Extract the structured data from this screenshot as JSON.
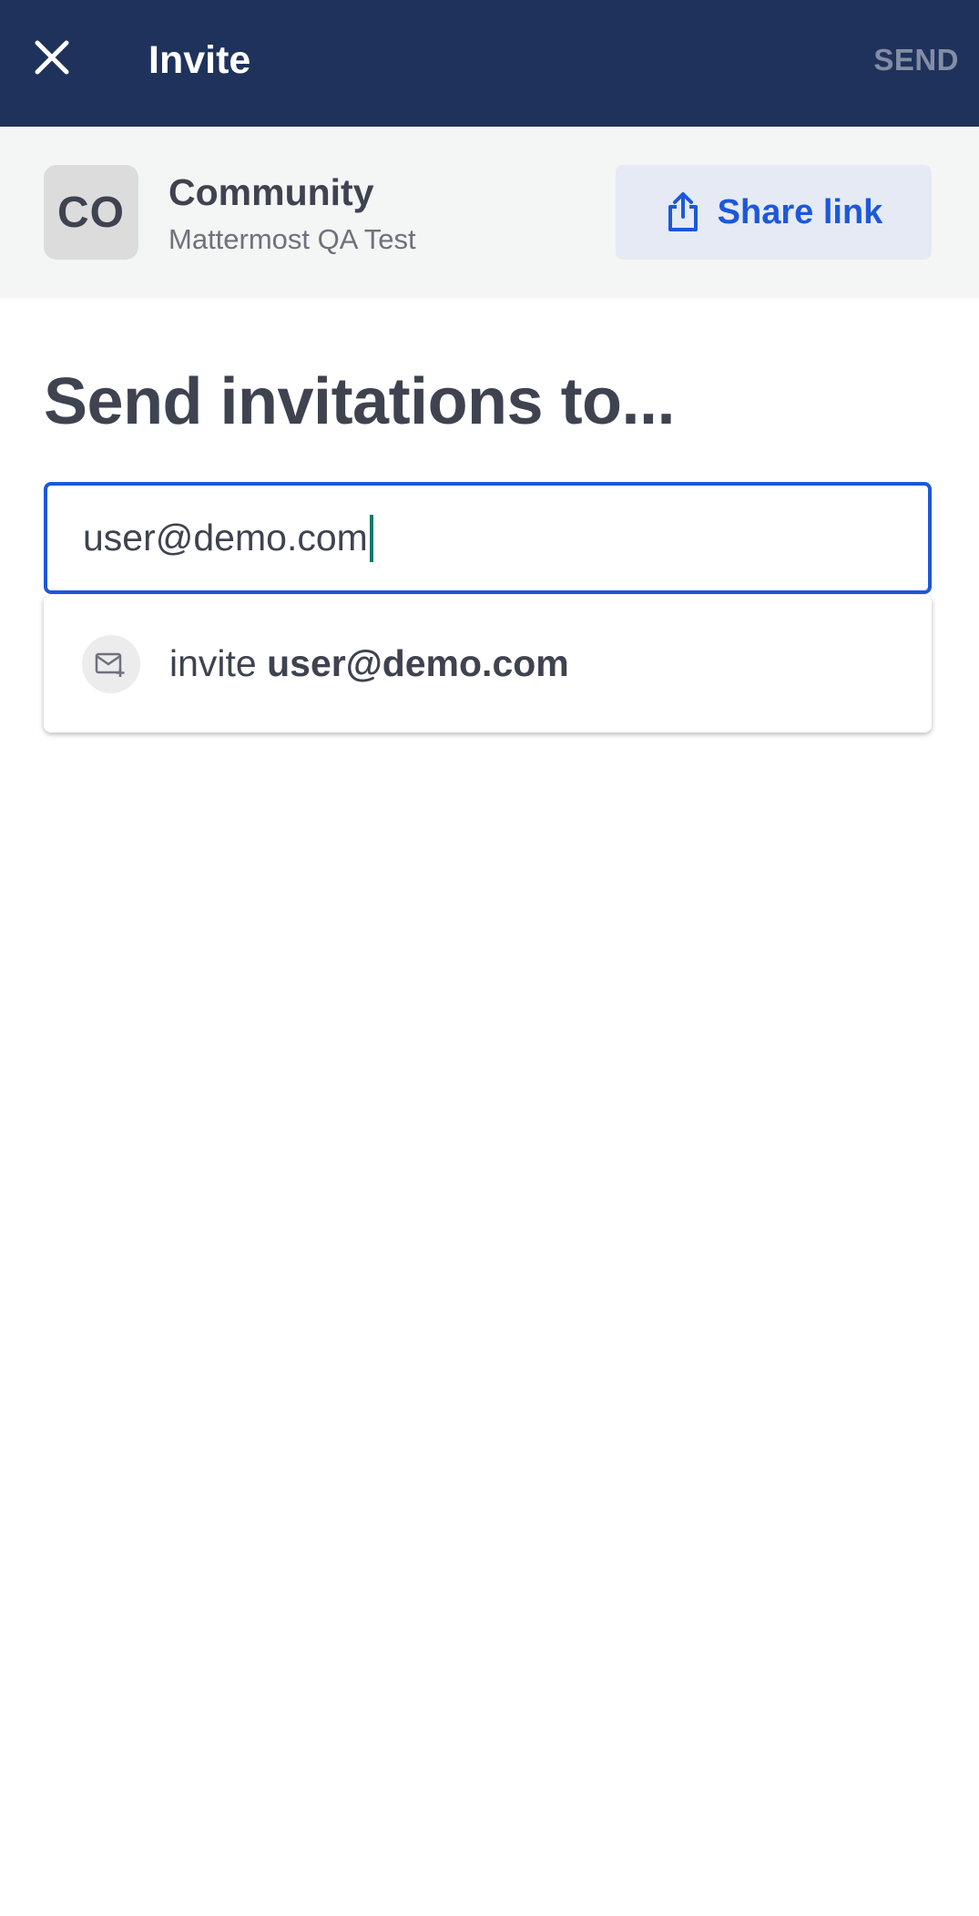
{
  "header": {
    "title": "Invite",
    "send_label": "SEND"
  },
  "team": {
    "initials": "CO",
    "name": "Community",
    "subtitle": "Mattermost QA Test",
    "share_label": "Share link"
  },
  "heading": "Send invitations to...",
  "search": {
    "value": "user@demo.com"
  },
  "suggestion": {
    "prefix": "invite",
    "email": "user@demo.com"
  },
  "colors": {
    "header_bg": "#1e325c",
    "accent": "#1c58d9",
    "team_bar_bg": "#f4f5f5",
    "share_bg": "#e5eaf5",
    "caret": "#0e7a6b"
  }
}
